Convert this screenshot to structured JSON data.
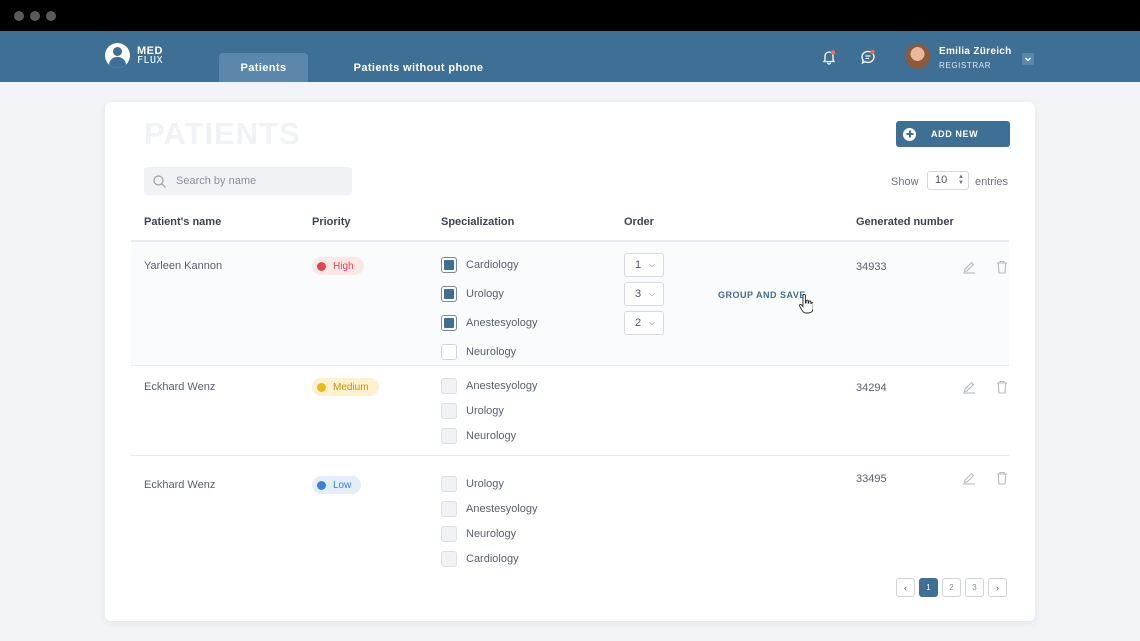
{
  "brand": {
    "line1": "MED",
    "line2": "FLUX"
  },
  "nav": {
    "tabs": [
      {
        "label": "Patients"
      },
      {
        "label": "Patients without phone"
      }
    ],
    "user": {
      "name": "Emilia Züreich",
      "role": "REGISTRAR"
    }
  },
  "page": {
    "title": "PATIENTS",
    "add_new": "ADD NEW",
    "search_placeholder": "Search by name",
    "show_label": "Show",
    "entries_value": "10",
    "entries_label": "entries"
  },
  "table": {
    "headers": [
      "Patient's name",
      "Priority",
      "Specialization",
      "Order",
      "Generated number"
    ],
    "group_and_save": "GROUP AND SAVE",
    "rows": [
      {
        "name": "Yarleen Kannon",
        "priority": "High",
        "generated": "34933",
        "specs": [
          {
            "label": "Cardiology",
            "checked": true,
            "order": "1"
          },
          {
            "label": "Urology",
            "checked": true,
            "order": "3"
          },
          {
            "label": "Anestesyology",
            "checked": true,
            "order": "2"
          },
          {
            "label": "Neurology",
            "checked": false
          }
        ]
      },
      {
        "name": "Eckhard Wenz",
        "priority": "Medium",
        "generated": "34294",
        "specs": [
          {
            "label": "Anestesyology",
            "checked": false
          },
          {
            "label": "Urology",
            "checked": false
          },
          {
            "label": "Neurology",
            "checked": false
          }
        ]
      },
      {
        "name": "Eckhard Wenz",
        "priority": "Low",
        "generated": "33495",
        "specs": [
          {
            "label": "Urology",
            "checked": false
          },
          {
            "label": "Anestesyology",
            "checked": false
          },
          {
            "label": "Neurology",
            "checked": false
          },
          {
            "label": "Cardiology",
            "checked": false
          }
        ]
      }
    ]
  },
  "pagination": {
    "pages": [
      "1",
      "2",
      "3"
    ],
    "current": "1"
  },
  "colors": {
    "primary": "#3e6f95",
    "high_bg": "#fde8e8",
    "high_dot": "#e0474c",
    "high_text": "#e0474c",
    "medium_bg": "#fdf1cf",
    "medium_dot": "#f1b814",
    "medium_text": "#c79206",
    "low_bg": "#e3eefb",
    "low_dot": "#3d7fd6",
    "low_text": "#3d7fd6"
  }
}
